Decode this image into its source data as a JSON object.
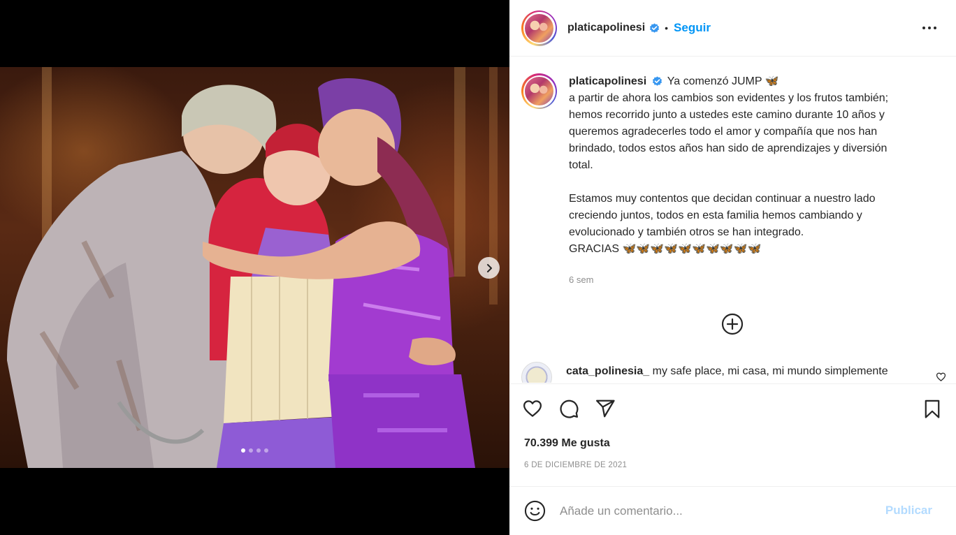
{
  "post": {
    "username": "platicapolinesi",
    "follow_label": "Seguir",
    "separator": "•",
    "caption": {
      "first_line": "Ya comenzó JUMP 🦋",
      "lines_a": [
        "a partir de ahora los cambios son evidentes y los frutos también;",
        "hemos recorrido junto a ustedes este camino durante 10 años y",
        "queremos agradecerles todo el amor y compañía que nos han",
        "brindado, todos estos años han sido de aprendizajes y diversión",
        "total."
      ],
      "lines_b": [
        "Estamos muy contentos que decidan continuar a nuestro lado",
        "creciendo juntos, todos en esta familia hemos cambiando y",
        "evolucionado y también otros se han integrado.",
        "GRACIAS 🦋🦋🦋🦋🦋🦋🦋🦋🦋🦋"
      ]
    },
    "time_ago": "6 sem",
    "comment": {
      "username": "cata_polinesia_",
      "text": "my safe place, mi casa, mi mundo simplemente"
    },
    "likes": "70.399 Me gusta",
    "date": "6 DE DICIEMBRE DE 2021",
    "add_comment_placeholder": "Añade un comentario...",
    "publish_label": "Publicar",
    "carousel": {
      "current": 1,
      "total": 4
    }
  },
  "icons": {
    "verified": "verified-badge-icon",
    "more": "more-options-icon",
    "next": "chevron-right-icon",
    "plus": "load-more-plus-icon",
    "like": "heart-icon",
    "comment": "comment-icon",
    "share": "share-icon",
    "save": "bookmark-icon",
    "emoji": "emoji-icon"
  },
  "colors": {
    "accent": "#0095f6",
    "publish_disabled": "#b3dbff",
    "muted": "#8e8e8e",
    "text": "#262626"
  }
}
